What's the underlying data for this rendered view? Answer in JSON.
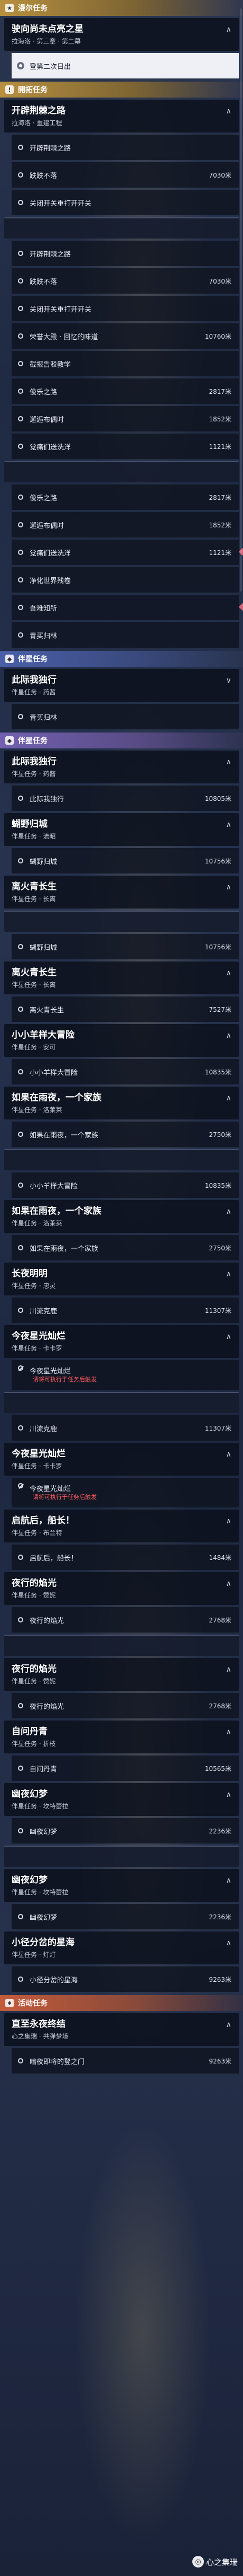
{
  "items": [
    {
      "t": "section",
      "style": "gold",
      "icon": "★",
      "label": "漫尔任务"
    },
    {
      "t": "card",
      "title": "驶向尚未点亮之星",
      "sub": "拉海洛 · 第三章 · 第二幕",
      "chev": "∧"
    },
    {
      "t": "step",
      "label": "登第二次日出",
      "selected": true
    },
    {
      "t": "section",
      "style": "gold",
      "icon": "!",
      "label": "開拓任务"
    },
    {
      "t": "card",
      "title": "开辟荆棘之路",
      "sub": "拉海洛 · 重建工程",
      "chev": "∧"
    },
    {
      "t": "step",
      "label": "开辟荆棘之路"
    },
    {
      "t": "step",
      "label": "跌跌不落",
      "dist": "7030米"
    },
    {
      "t": "step",
      "label": "关闭开关重打开开关"
    },
    {
      "t": "card",
      "title": "",
      "sub": "",
      "chev": ""
    },
    {
      "t": "step",
      "label": "开辟荆棘之路"
    },
    {
      "t": "step",
      "label": "跌跌不落",
      "dist": "7030米"
    },
    {
      "t": "step",
      "label": "关闭开关重打开开关"
    },
    {
      "t": "step",
      "label": "荣誉大殿 · 回忆的味道",
      "dist": "10760米"
    },
    {
      "t": "step",
      "label": "截报告驳教学"
    },
    {
      "t": "step",
      "label": "俊乐之路",
      "dist": "2817米"
    },
    {
      "t": "step",
      "label": "邂逅布偶时",
      "dist": "1852米"
    },
    {
      "t": "step",
      "label": "觉痛们送洗洋",
      "dist": "1121米"
    },
    {
      "t": "card",
      "title": "",
      "sub": "",
      "chev": ""
    },
    {
      "t": "step",
      "label": "俊乐之路",
      "dist": "2817米"
    },
    {
      "t": "step",
      "label": "邂逅布偶时",
      "dist": "1852米"
    },
    {
      "t": "step",
      "label": "觉痛们送洗洋",
      "dist": "1121米",
      "diamond": true
    },
    {
      "t": "step",
      "label": "净化世界残卷"
    },
    {
      "t": "step",
      "label": "吾难知所",
      "diamond": true
    },
    {
      "t": "step",
      "label": "青买归林"
    },
    {
      "t": "section",
      "style": "blue",
      "icon": "◆",
      "label": "伴星任务"
    },
    {
      "t": "card",
      "title": "此际我独行",
      "sub": "伴星任务 · 药酱",
      "chev": "∨"
    },
    {
      "t": "step",
      "label": "青买归林"
    },
    {
      "t": "section",
      "style": "purple",
      "icon": "◆",
      "label": "伴星任务"
    },
    {
      "t": "card",
      "title": "此际我独行",
      "sub": "伴星任务 · 药酱",
      "chev": "∧"
    },
    {
      "t": "step",
      "label": "此际我独行",
      "dist": "10805米"
    },
    {
      "t": "card",
      "title": "蝴野归城",
      "sub": "伴星任务 · 流昭",
      "chev": "∧"
    },
    {
      "t": "step",
      "label": "蝴野归城",
      "dist": "10756米"
    },
    {
      "t": "card",
      "title": "离火青长生",
      "sub": "伴星任务 · 长离",
      "chev": "∧"
    },
    {
      "t": "card",
      "title": "",
      "sub": "",
      "chev": ""
    },
    {
      "t": "step",
      "label": "蝴野归城",
      "dist": "10756米"
    },
    {
      "t": "card",
      "title": "离火青长生",
      "sub": "伴星任务 · 长离",
      "chev": "∧"
    },
    {
      "t": "step",
      "label": "离火青长生",
      "dist": "7527米"
    },
    {
      "t": "card",
      "title": "小小羊样大冒险",
      "sub": "伴星任务 · 安可",
      "chev": "∧"
    },
    {
      "t": "step",
      "label": "小小羊样大冒险",
      "dist": "10835米"
    },
    {
      "t": "card",
      "title": "如果在雨夜，一个家族",
      "sub": "伴星任务 · 洛莱莱",
      "chev": "∧"
    },
    {
      "t": "step",
      "label": "如果在雨夜，一个家族",
      "dist": "2750米"
    },
    {
      "t": "card",
      "title": "",
      "sub": "",
      "chev": ""
    },
    {
      "t": "step",
      "label": "小小羊样大冒险",
      "dist": "10835米"
    },
    {
      "t": "card",
      "title": "如果在雨夜，一个家族",
      "sub": "伴星任务 · 洛莱莱",
      "chev": "∧"
    },
    {
      "t": "step",
      "label": "如果在雨夜，一个家族",
      "dist": "2750米"
    },
    {
      "t": "card",
      "title": "长夜明明",
      "sub": "伴星任务 · 忠灵",
      "chev": "∧"
    },
    {
      "t": "step",
      "label": "川流克鹿",
      "dist": "11307米"
    },
    {
      "t": "card",
      "title": "今夜星光灿烂",
      "sub": "伴星任务 · 卡卡罗",
      "chev": "∧"
    },
    {
      "t": "step",
      "label": "今夜星光灿烂",
      "warn": "请将可执行于任务后触发",
      "x": true
    },
    {
      "t": "card",
      "title": "",
      "sub": "",
      "chev": ""
    },
    {
      "t": "step",
      "label": "川流克鹿",
      "dist": "11307米"
    },
    {
      "t": "card",
      "title": "今夜星光灿烂",
      "sub": "伴星任务 · 卡卡罗",
      "chev": "∧"
    },
    {
      "t": "step",
      "label": "今夜星光灿烂",
      "warn": "请将可执行于任务后触发",
      "x": true
    },
    {
      "t": "card",
      "title": "启航后，船长！",
      "sub": "伴星任务 · 布兰特",
      "chev": "∧"
    },
    {
      "t": "step",
      "label": "启航后，船长！",
      "dist": "1484米"
    },
    {
      "t": "card",
      "title": "夜行的焰光",
      "sub": "伴星任务 · 赞妮",
      "chev": "∧"
    },
    {
      "t": "step",
      "label": "夜行的焰光",
      "dist": "2768米"
    },
    {
      "t": "card",
      "title": "",
      "sub": "",
      "chev": ""
    },
    {
      "t": "card",
      "title": "夜行的焰光",
      "sub": "伴星任务 · 赞妮",
      "chev": "∧"
    },
    {
      "t": "step",
      "label": "夜行的焰光",
      "dist": "2768米"
    },
    {
      "t": "card",
      "title": "自问丹青",
      "sub": "伴星任务 · 折枝",
      "chev": "∧"
    },
    {
      "t": "step",
      "label": "自问丹青",
      "dist": "10565米"
    },
    {
      "t": "card",
      "title": "幽夜幻梦",
      "sub": "伴星任务 · 坎特蕾拉",
      "chev": "∧"
    },
    {
      "t": "step",
      "label": "幽夜幻梦",
      "dist": "2236米"
    },
    {
      "t": "card",
      "title": "",
      "sub": "",
      "chev": ""
    },
    {
      "t": "card",
      "title": "幽夜幻梦",
      "sub": "伴星任务 · 坎特蕾拉",
      "chev": "∧"
    },
    {
      "t": "step",
      "label": "幽夜幻梦",
      "dist": "2236米"
    },
    {
      "t": "card",
      "title": "小径分岔的星海",
      "sub": "伴星任务 · 灯灯",
      "chev": "∧"
    },
    {
      "t": "step",
      "label": "小径分岔的星海",
      "dist": "9263米"
    },
    {
      "t": "section",
      "style": "red",
      "icon": "♦",
      "label": "活动任务"
    },
    {
      "t": "card",
      "title": "直至永夜终结",
      "sub": "心之集瑞 · 共弹梦境",
      "chev": "∧"
    },
    {
      "t": "step",
      "label": "暗夜即将的登之门",
      "dist": "9263米"
    }
  ],
  "logo": {
    "mark": "◎",
    "text": "心之集瑞"
  }
}
